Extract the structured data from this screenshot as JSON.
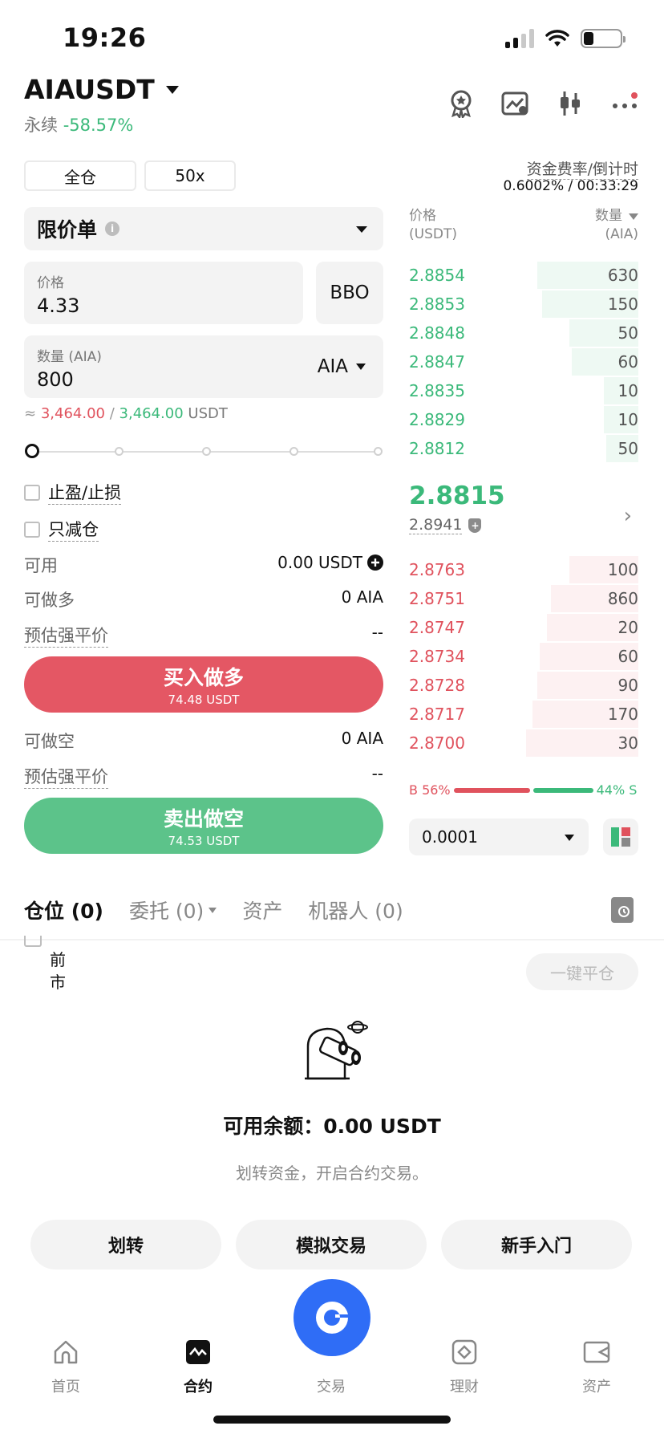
{
  "status_bar": {
    "time": "19:26"
  },
  "header": {
    "pair": "AIAUSDT",
    "type": "永续",
    "change": "-58.57%",
    "icons": [
      "award-icon",
      "chart-icon",
      "candlestick-icon",
      "more-icon"
    ]
  },
  "margin": {
    "mode": "全仓",
    "leverage": "50x"
  },
  "funding": {
    "label": "资金费率/倒计时",
    "value": "0.6002% / 00:33:29"
  },
  "order": {
    "type": "限价单",
    "price_label": "价格",
    "price_value": "4.33",
    "bbo": "BBO",
    "qty_label": "数量 (AIA)",
    "qty_value": "800",
    "qty_unit": "AIA",
    "approx_prefix": "≈",
    "approx_buy": "3,464.00",
    "approx_sep": "/",
    "approx_sell": "3,464.00",
    "approx_unit": "USDT",
    "tp_sl": "止盈/止损",
    "reduce_only": "只减仓",
    "available_label": "可用",
    "available_value": "0.00 USDT",
    "can_long_label": "可做多",
    "can_long_value": "0 AIA",
    "liq_label": "预估强平价",
    "liq_value": "--",
    "buy_label": "买入做多",
    "buy_cost": "74.48 USDT",
    "can_short_label": "可做空",
    "can_short_value": "0 AIA",
    "liq_label2": "预估强平价",
    "liq_value2": "--",
    "sell_label": "卖出做空",
    "sell_cost": "74.53 USDT",
    "slider_percent": 0
  },
  "orderbook": {
    "price_header": "价格",
    "price_unit": "(USDT)",
    "qty_header": "数量",
    "qty_unit": "(AIA)",
    "asks": [
      {
        "price": "2.8854",
        "qty": "630",
        "depth": 0.44
      },
      {
        "price": "2.8853",
        "qty": "150",
        "depth": 0.42
      },
      {
        "price": "2.8848",
        "qty": "50",
        "depth": 0.3
      },
      {
        "price": "2.8847",
        "qty": "60",
        "depth": 0.29
      },
      {
        "price": "2.8835",
        "qty": "10",
        "depth": 0.15
      },
      {
        "price": "2.8829",
        "qty": "10",
        "depth": 0.15
      },
      {
        "price": "2.8812",
        "qty": "50",
        "depth": 0.14
      }
    ],
    "last_price": "2.8815",
    "mark_price": "2.8941",
    "bids": [
      {
        "price": "2.8763",
        "qty": "100",
        "depth": 0.3
      },
      {
        "price": "2.8751",
        "qty": "860",
        "depth": 0.38
      },
      {
        "price": "2.8747",
        "qty": "20",
        "depth": 0.4
      },
      {
        "price": "2.8734",
        "qty": "60",
        "depth": 0.43
      },
      {
        "price": "2.8728",
        "qty": "90",
        "depth": 0.44
      },
      {
        "price": "2.8717",
        "qty": "170",
        "depth": 0.46
      },
      {
        "price": "2.8700",
        "qty": "30",
        "depth": 0.49
      }
    ],
    "buy_ratio": "B 56%",
    "sell_ratio": "44% S",
    "buy_share": 0.56,
    "precision": "0.0001"
  },
  "tabs": {
    "positions": "仓位 (0)",
    "orders": "委托 (0)",
    "assets": "资产",
    "bots": "机器人 (0)"
  },
  "positions": {
    "close_all": "一键平仓",
    "current_market": "前市"
  },
  "empty_state": {
    "title": "可用余额：0.00 USDT",
    "subtitle": "划转资金，开启合约交易。",
    "transfer": "划转",
    "demo": "模拟交易",
    "beginner": "新手入门"
  },
  "nav": {
    "home": "首页",
    "futures": "合约",
    "trade": "交易",
    "earn": "理财",
    "assets": "资产"
  },
  "colors": {
    "green": "#3bb97a",
    "red": "#e0525d",
    "accent": "#2f6df6"
  }
}
